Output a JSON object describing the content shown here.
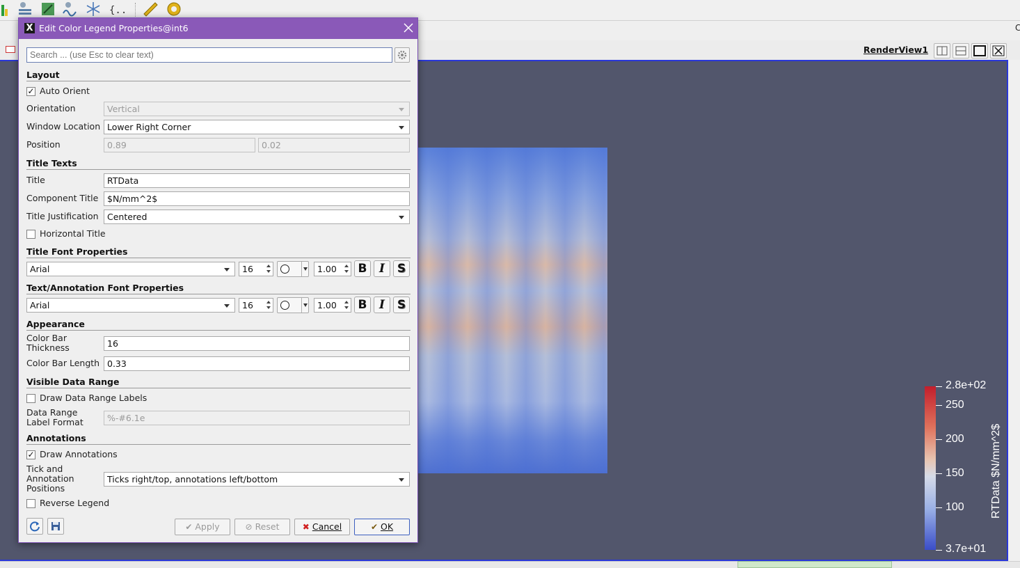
{
  "toolbar": {
    "icons": [
      "bar-chart-icon",
      "group-datasets-icon",
      "edit-icon",
      "plot-over-time-icon",
      "snowflake-icon",
      "code-braces-icon",
      "ruler-icon",
      "protractor-icon"
    ]
  },
  "view": {
    "title": "RenderView1",
    "right_partial_text": "C",
    "legend": {
      "labels": [
        "2.8e+02",
        "250",
        "200",
        "150",
        "100",
        "3.7e+01"
      ],
      "title": "RTData $N/mm^2$"
    }
  },
  "dialog": {
    "title": "Edit Color Legend Properties@int6",
    "search_placeholder": "Search ... (use Esc to clear text)",
    "sections": {
      "layout": "Layout",
      "title_texts": "Title Texts",
      "title_font": "Title Font Properties",
      "text_font": "Text/Annotation Font Properties",
      "appearance": "Appearance",
      "visible_range": "Visible Data Range",
      "annotations": "Annotations"
    },
    "layout": {
      "auto_orient_label": "Auto Orient",
      "auto_orient_checked": "✓",
      "orientation_label": "Orientation",
      "orientation_value": "Vertical",
      "window_location_label": "Window Location",
      "window_location_value": "Lower Right Corner",
      "position_label": "Position",
      "position_x": "0.89",
      "position_y": "0.02"
    },
    "title_texts": {
      "title_label": "Title",
      "title_value": "RTData",
      "component_title_label": "Component Title",
      "component_title_value": "$N/mm^2$",
      "justification_label": "Title Justification",
      "justification_value": "Centered",
      "horizontal_title_label": "Horizontal Title"
    },
    "title_font": {
      "family": "Arial",
      "size": "16",
      "opacity": "1.00",
      "bold": "B",
      "italic": "I",
      "shadow": "S"
    },
    "text_font": {
      "family": "Arial",
      "size": "16",
      "opacity": "1.00",
      "bold": "B",
      "italic": "I",
      "shadow": "S"
    },
    "appearance": {
      "thickness_label": "Color Bar Thickness",
      "thickness_value": "16",
      "length_label": "Color Bar Length",
      "length_value": "0.33"
    },
    "visible_range": {
      "draw_labels_label": "Draw Data Range Labels",
      "format_label": "Data Range Label Format",
      "format_value": "%-#6.1e"
    },
    "annotations": {
      "draw_annotations_label": "Draw Annotations",
      "draw_annotations_checked": "✓",
      "positions_label": "Tick and Annotation Positions",
      "positions_value": "Ticks right/top, annotations left/bottom",
      "reverse_label": "Reverse Legend"
    },
    "buttons": {
      "apply": "Apply",
      "reset": "Reset",
      "cancel": "Cancel",
      "ok": "OK"
    }
  }
}
